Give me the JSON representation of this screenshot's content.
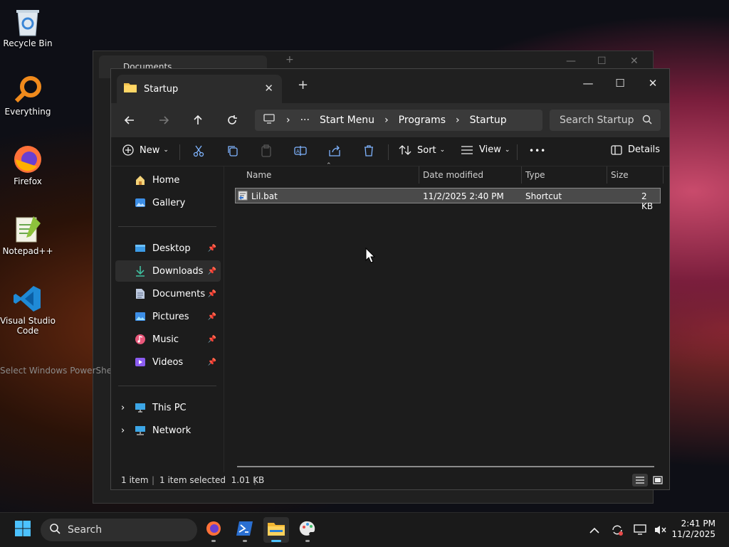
{
  "desktop": {
    "icons": [
      {
        "label": "Recycle Bin",
        "icon": "recycle-bin-icon"
      },
      {
        "label": "Everything",
        "icon": "everything-icon"
      },
      {
        "label": "Firefox",
        "icon": "firefox-icon"
      },
      {
        "label": "Notepad++",
        "icon": "notepadpp-icon"
      },
      {
        "label": "Visual Studio Code",
        "icon": "vscode-icon"
      }
    ],
    "tooltip": "Select Windows PowerShell"
  },
  "background_window": {
    "tab_title": "Documents",
    "tab_add": "+"
  },
  "explorer": {
    "tab_title": "Startup",
    "tab_add": "+",
    "window_controls": {
      "minimize": "—",
      "maximize": "☐",
      "close": "✕"
    },
    "breadcrumb": [
      "Start Menu",
      "Programs",
      "Startup"
    ],
    "search_placeholder": "Search Startup",
    "toolbar": {
      "new_label": "New",
      "sort_label": "Sort",
      "view_label": "View",
      "more_label": "•••",
      "details_label": "Details"
    },
    "sidebar": {
      "top": [
        {
          "label": "Home",
          "icon": "home-icon"
        },
        {
          "label": "Gallery",
          "icon": "gallery-icon"
        }
      ],
      "pinned": [
        {
          "label": "Desktop",
          "icon": "desktop-folder-icon"
        },
        {
          "label": "Downloads",
          "icon": "downloads-icon"
        },
        {
          "label": "Documents",
          "icon": "documents-icon"
        },
        {
          "label": "Pictures",
          "icon": "pictures-icon"
        },
        {
          "label": "Music",
          "icon": "music-icon"
        },
        {
          "label": "Videos",
          "icon": "videos-icon"
        }
      ],
      "bottom": [
        {
          "label": "This PC",
          "icon": "this-pc-icon"
        },
        {
          "label": "Network",
          "icon": "network-icon"
        }
      ]
    },
    "columns": [
      "Name",
      "Date modified",
      "Type",
      "Size"
    ],
    "files": [
      {
        "name": "Lil.bat",
        "date_modified": "11/2/2025 2:40 PM",
        "type": "Shortcut",
        "size": "2 KB"
      }
    ],
    "status": {
      "item_count": "1 item",
      "selection": "1 item selected  1.01 KB"
    }
  },
  "taskbar": {
    "search_label": "Search",
    "time": "2:41 PM",
    "date": "11/2/2025"
  }
}
